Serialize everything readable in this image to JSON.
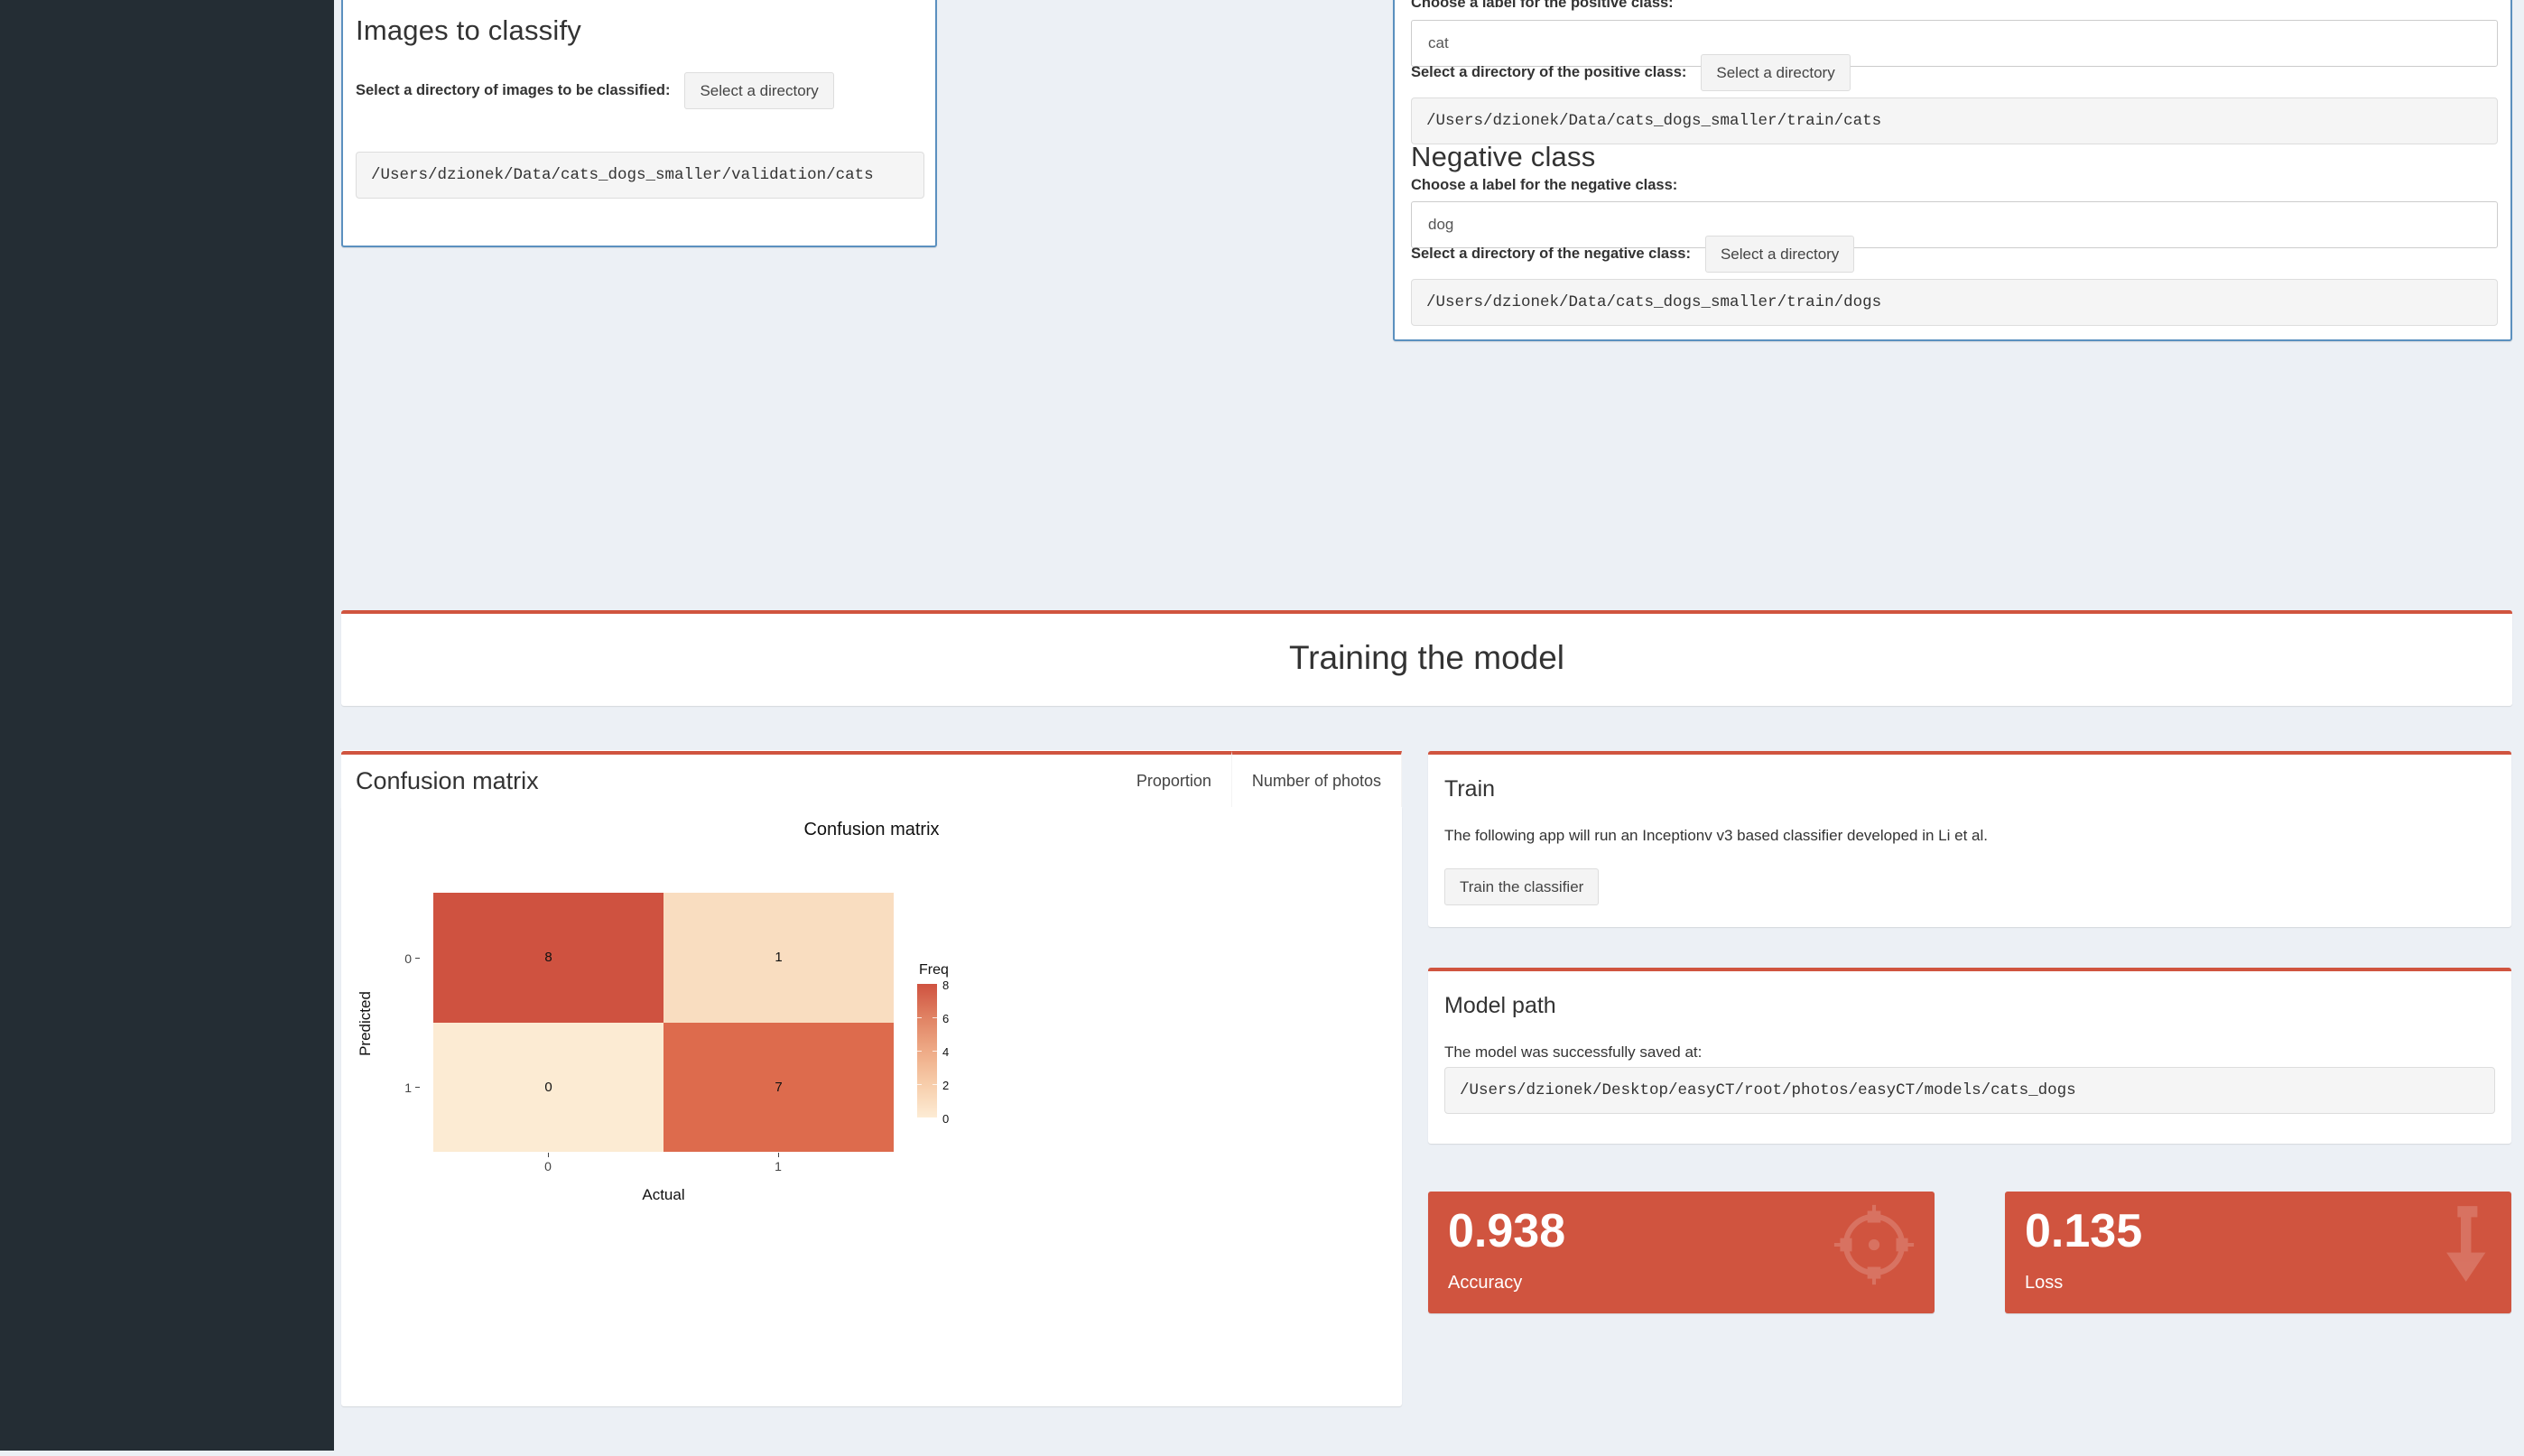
{
  "theme": {
    "sidebar_bg": "#242d34",
    "page_bg": "#ecf0f5",
    "accent_red": "#d0543f",
    "box_border_blue": "#5b90bf"
  },
  "left_panel": {
    "title": "Images to classify",
    "select_dir_label": "Select a directory of images to be classified:",
    "select_dir_button": "Select a directory",
    "selected_path": "/Users/dzionek/Data/cats_dogs_smaller/validation/cats"
  },
  "right_panel": {
    "positive_class": {
      "label_prompt": "Choose a label for the positive class:",
      "label_value": "cat",
      "select_dir_label": "Select a directory of the positive class:",
      "select_dir_button": "Select a directory",
      "selected_path": "/Users/dzionek/Data/cats_dogs_smaller/train/cats"
    },
    "negative_class": {
      "title": "Negative class",
      "label_prompt": "Choose a label for the negative class:",
      "label_value": "dog",
      "select_dir_label": "Select a directory of the negative class:",
      "select_dir_button": "Select a directory",
      "selected_path": "/Users/dzionek/Data/cats_dogs_smaller/train/dogs"
    }
  },
  "section_header": {
    "title": "Training the model"
  },
  "confusion_box": {
    "title": "Confusion matrix",
    "tabs": [
      {
        "label": "Proportion",
        "active": false
      },
      {
        "label": "Number of photos",
        "active": true
      }
    ]
  },
  "train_box": {
    "title": "Train",
    "description": "The following app will run an Inceptionv v3 based classifier developed in Li et al.",
    "button": "Train the classifier"
  },
  "model_path_box": {
    "title": "Model path",
    "description": "The model was successfully saved at:",
    "path": "/Users/dzionek/Desktop/easyCT/root/photos/easyCT/models/cats_dogs"
  },
  "value_boxes": [
    {
      "value": "0.938",
      "label": "Accuracy",
      "icon": "crosshairs-icon",
      "color": "#d0543f"
    },
    {
      "value": "0.135",
      "label": "Loss",
      "icon": "level-down-arrow-icon",
      "color": "#d0543f"
    }
  ],
  "chart_data": {
    "type": "heatmap",
    "title": "Confusion matrix",
    "xlabel": "Actual",
    "ylabel": "Predicted",
    "x_categories": [
      "0",
      "1"
    ],
    "y_categories": [
      "0",
      "1"
    ],
    "matrix": [
      [
        8,
        1
      ],
      [
        0,
        7
      ]
    ],
    "cell_labels": [
      [
        "8",
        "1"
      ],
      [
        "0",
        "7"
      ]
    ],
    "cell_colors": [
      [
        "#cf5240",
        "#f9ddc0"
      ],
      [
        "#fcebd3",
        "#dd6b4d"
      ]
    ],
    "legend": {
      "title": "Freq",
      "position": "right",
      "ticks": [
        8,
        6,
        4,
        2,
        0
      ],
      "tick_labels": [
        "8",
        "6",
        "4",
        "2",
        "0"
      ],
      "min": 0,
      "max": 8,
      "colormap_low": "#fdebd3",
      "colormap_high": "#cf5240"
    },
    "grid": false
  }
}
